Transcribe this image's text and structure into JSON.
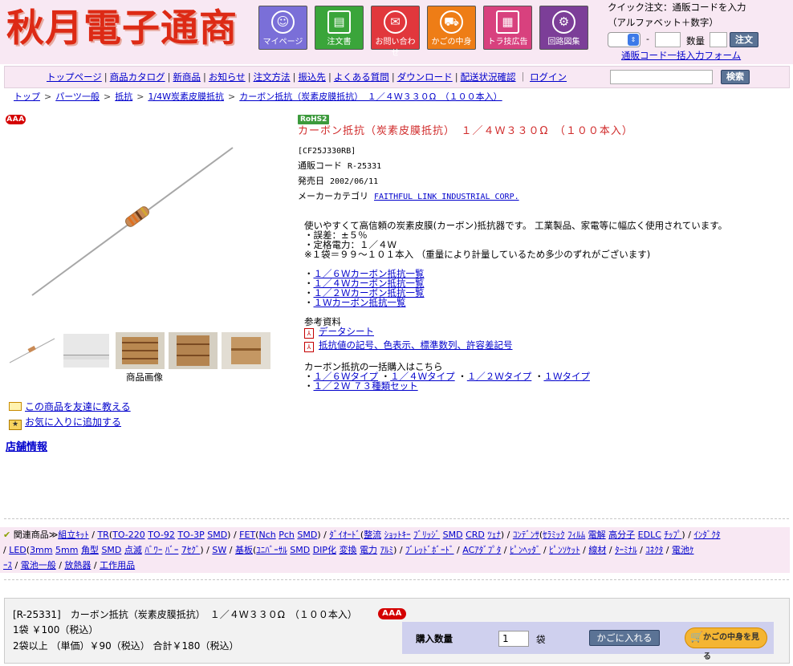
{
  "header": {
    "logo": "秋月電子通商",
    "nav": [
      {
        "label": "マイページ",
        "icon": "person-icon",
        "color": "#7a6fd8"
      },
      {
        "label": "注文書",
        "icon": "form-icon",
        "color": "#3aa53a"
      },
      {
        "label": "お問い合わせ",
        "icon": "mail-icon",
        "color": "#e1373c"
      },
      {
        "label": "かごの中身",
        "icon": "cart-icon",
        "color": "#ee7d16"
      },
      {
        "label": "トラ技広告",
        "icon": "calculator-icon",
        "color": "#d8417e"
      },
      {
        "label": "回路図集",
        "icon": "circuit-icon",
        "color": "#7c3e98"
      }
    ],
    "quick_order": {
      "title": "クイック注文：通販コードを入力",
      "subtitle": "（アルファベット＋数字）",
      "dash": "-",
      "qty_label": "数量",
      "order_button": "注文",
      "bulk_link": "通販コード一括入力フォーム"
    }
  },
  "menu": {
    "items": [
      "トップページ",
      "商品カタログ",
      "新商品",
      "お知らせ",
      "注文方法",
      "振込先",
      "よくある質問",
      "ダウンロード",
      "配送状況確認",
      "ログイン"
    ],
    "search_button": "検索"
  },
  "breadcrumb": [
    "トップ",
    "パーツ一般",
    "抵抗",
    "1/4W炭素皮膜抵抗",
    "カーボン抵抗（炭素皮膜抵抗）　１／４Ｗ３３０Ω　（１００本入）"
  ],
  "product": {
    "grade_badge": "AAA",
    "rohs": "RoHS2",
    "title": "カーボン抵抗（炭素皮膜抵抗）　１／４Ｗ３３０Ω　（１００本入）",
    "part_number": "[CF25J330RB]",
    "code_label": "通販コード",
    "code": "R-25331",
    "date_label": "発売日",
    "date": "2002/06/11",
    "maker_label": "メーカーカテゴリ",
    "maker": "FAITHFUL LINK INDUSTRIAL CORP.",
    "desc": [
      "使いやすくて高信頼の炭素皮膜(カーボン)抵抗器です。 工業製品、家電等に幅広く使用されています。",
      "・誤差：±５％",
      "・定格電力：１／４Ｗ",
      "※１袋＝９９～１０１本入 （重量により計量しているため多少のずれがございます)"
    ],
    "list_links": [
      "１／６Ｗカーボン抵抗一覧",
      "１／４Ｗカーボン抵抗一覧",
      "１／２Ｗカーボン抵抗一覧",
      "１Ｗカーボン抵抗一覧"
    ],
    "ref_title": "参考資料",
    "ref_links": [
      "データシート",
      "抵抗値の記号、色表示、標準数列、許容差記号"
    ],
    "bulk_title": "カーボン抵抗の一括購入はこちら",
    "bulk_links": [
      "１／６Ｗタイプ",
      "１／４Ｗタイプ",
      "１／２Ｗタイプ",
      "１Ｗタイプ",
      "１／２Ｗ ７３種類セット"
    ],
    "image_caption": "商品画像"
  },
  "side": {
    "friend_link": "この商品を友達に教える",
    "favorite_link": "お気に入りに追加する",
    "shop_info": "店舗情報"
  },
  "related": {
    "label": "関連商品≫",
    "line1": [
      {
        "t": "組立ｷｯﾄ",
        "l": true
      },
      {
        "t": " / ",
        "l": false
      },
      {
        "t": "TR",
        "l": true
      },
      {
        "t": "(",
        "l": false
      },
      {
        "t": "TO-220",
        "l": true
      },
      {
        "t": " ",
        "l": false
      },
      {
        "t": "TO-92",
        "l": true
      },
      {
        "t": " ",
        "l": false
      },
      {
        "t": "TO-3P",
        "l": true
      },
      {
        "t": " ",
        "l": false
      },
      {
        "t": "SMD",
        "l": true
      },
      {
        "t": ") / ",
        "l": false
      },
      {
        "t": "FET",
        "l": true
      },
      {
        "t": "(",
        "l": false
      },
      {
        "t": "Nch",
        "l": true
      },
      {
        "t": " ",
        "l": false
      },
      {
        "t": "Pch",
        "l": true
      },
      {
        "t": " ",
        "l": false
      },
      {
        "t": "SMD",
        "l": true
      },
      {
        "t": ") / ",
        "l": false
      },
      {
        "t": "ﾀﾞｲｵｰﾄﾞ",
        "l": true
      },
      {
        "t": "(",
        "l": false
      },
      {
        "t": "整流",
        "l": true
      },
      {
        "t": " ",
        "l": false
      },
      {
        "t": "ｼｮｯﾄｷｰ",
        "l": true
      },
      {
        "t": " ",
        "l": false
      },
      {
        "t": "ﾌﾞﾘｯｼﾞ",
        "l": true
      },
      {
        "t": " ",
        "l": false
      },
      {
        "t": "SMD",
        "l": true
      },
      {
        "t": " ",
        "l": false
      },
      {
        "t": "CRD",
        "l": true
      },
      {
        "t": " ",
        "l": false
      },
      {
        "t": "ﾂｪﾅ",
        "l": true
      },
      {
        "t": ") / ",
        "l": false
      },
      {
        "t": "ｺﾝﾃﾞﾝｻ",
        "l": true
      },
      {
        "t": "(",
        "l": false
      },
      {
        "t": "ｾﾗﾐｯｸ",
        "l": true
      },
      {
        "t": " ",
        "l": false
      },
      {
        "t": "ﾌｨﾙﾑ",
        "l": true
      },
      {
        "t": " ",
        "l": false
      },
      {
        "t": "電解",
        "l": true
      },
      {
        "t": " ",
        "l": false
      },
      {
        "t": "高分子",
        "l": true
      },
      {
        "t": " ",
        "l": false
      },
      {
        "t": "EDLC",
        "l": true
      },
      {
        "t": " ",
        "l": false
      },
      {
        "t": "ﾁｯﾌﾟ",
        "l": true
      },
      {
        "t": ") / ",
        "l": false
      },
      {
        "t": "ｲﾝﾀﾞｸﾀ",
        "l": true
      }
    ],
    "line2": [
      {
        "t": "/ ",
        "l": false
      },
      {
        "t": "LED",
        "l": true
      },
      {
        "t": "(",
        "l": false
      },
      {
        "t": "3mm",
        "l": true
      },
      {
        "t": " ",
        "l": false
      },
      {
        "t": "5mm",
        "l": true
      },
      {
        "t": " ",
        "l": false
      },
      {
        "t": "角型",
        "l": true
      },
      {
        "t": " ",
        "l": false
      },
      {
        "t": "SMD",
        "l": true
      },
      {
        "t": " ",
        "l": false
      },
      {
        "t": "点滅",
        "l": true
      },
      {
        "t": " ",
        "l": false
      },
      {
        "t": "ﾊﾞﾜｰ",
        "l": true
      },
      {
        "t": " ",
        "l": false
      },
      {
        "t": "ﾊﾞｰ",
        "l": true
      },
      {
        "t": " ",
        "l": false
      },
      {
        "t": "7ｾｸﾞ",
        "l": true
      },
      {
        "t": ") / ",
        "l": false
      },
      {
        "t": "SW",
        "l": true
      },
      {
        "t": " / ",
        "l": false
      },
      {
        "t": "基板",
        "l": true
      },
      {
        "t": "(",
        "l": false
      },
      {
        "t": "ﾕﾆﾊﾞｰｻﾙ",
        "l": true
      },
      {
        "t": " ",
        "l": false
      },
      {
        "t": "SMD",
        "l": true
      },
      {
        "t": " ",
        "l": false
      },
      {
        "t": "DIP化",
        "l": true
      },
      {
        "t": " ",
        "l": false
      },
      {
        "t": "変換",
        "l": true
      },
      {
        "t": " ",
        "l": false
      },
      {
        "t": "電力",
        "l": true
      },
      {
        "t": " ",
        "l": false
      },
      {
        "t": "ｱﾙﾐ",
        "l": true
      },
      {
        "t": ") / ",
        "l": false
      },
      {
        "t": "ﾌﾞﾚｯﾄﾞﾎﾞｰﾄﾞ",
        "l": true
      },
      {
        "t": " / ",
        "l": false
      },
      {
        "t": "ACｱﾀﾞﾌﾟﾀ",
        "l": true
      },
      {
        "t": " / ",
        "l": false
      },
      {
        "t": "ﾋﾟﾝﾍｯﾀﾞ",
        "l": true
      },
      {
        "t": " / ",
        "l": false
      },
      {
        "t": "ﾋﾟﾝｿｹｯﾄ",
        "l": true
      },
      {
        "t": " / ",
        "l": false
      },
      {
        "t": "線材",
        "l": true
      },
      {
        "t": " / ",
        "l": false
      },
      {
        "t": "ﾀｰﾐﾅﾙ",
        "l": true
      },
      {
        "t": " / ",
        "l": false
      },
      {
        "t": "ｺﾈｸﾀ",
        "l": true
      },
      {
        "t": " / ",
        "l": false
      },
      {
        "t": "電池ｹ",
        "l": true
      }
    ],
    "line3": [
      {
        "t": "ｰｽ",
        "l": true
      },
      {
        "t": " / ",
        "l": false
      },
      {
        "t": "電池一般",
        "l": true
      },
      {
        "t": " / ",
        "l": false
      },
      {
        "t": "放熱器",
        "l": true
      },
      {
        "t": " / ",
        "l": false
      },
      {
        "t": "工作用品",
        "l": true
      }
    ]
  },
  "purchase": {
    "code_title": "[R-25331]　カーボン抵抗（炭素皮膜抵抗）　１／４Ｗ３３０Ω　（１００本入）",
    "badge": "AAA",
    "price1": "1袋 ￥100（税込）",
    "price2": "2袋以上 （単価）￥90（税込） 合計￥180（税込）",
    "qty_label": "購入数量",
    "qty": "1",
    "unit": "袋",
    "cart_button": "かごに入れる",
    "view_cart": "かごの中身を見る"
  },
  "colors": {
    "header_bg": "#f8e8f3",
    "logo_red": "#dd2a15",
    "title_red": "#d02a2a",
    "badge_red": "#d40000",
    "link_blue": "#0000cc",
    "button_gray_blue": "#5b7395"
  }
}
